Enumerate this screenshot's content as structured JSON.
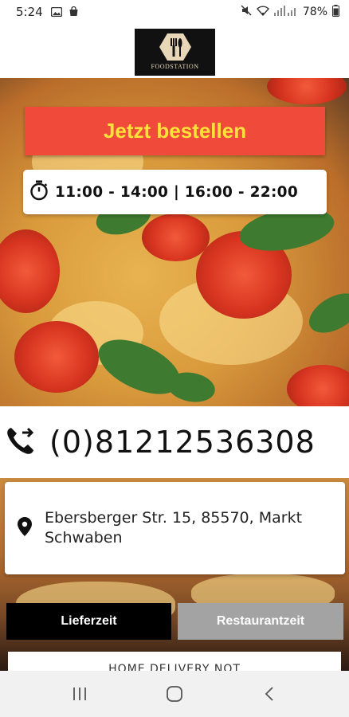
{
  "status_bar": {
    "time": "5:24",
    "battery": "78%"
  },
  "logo": {
    "text": "FOODSTATION"
  },
  "hero": {
    "order_button": "Jetzt bestellen",
    "hours": "11:00 - 14:00 | 16:00 - 22:00"
  },
  "contact": {
    "phone": "(0)81212536308",
    "address": "Ebersberger Str. 15, 85570, Markt Schwaben"
  },
  "tabs": [
    {
      "label": "Lieferzeit",
      "active": true
    },
    {
      "label": "Restaurantzeit",
      "active": false
    }
  ],
  "notice": "HOME DELIVERY NOT",
  "colors": {
    "order_button_bg": "#ef4a3a",
    "order_button_text": "#ffe23a",
    "active_tab": "#000000",
    "inactive_tab": "#a3a3a3"
  }
}
